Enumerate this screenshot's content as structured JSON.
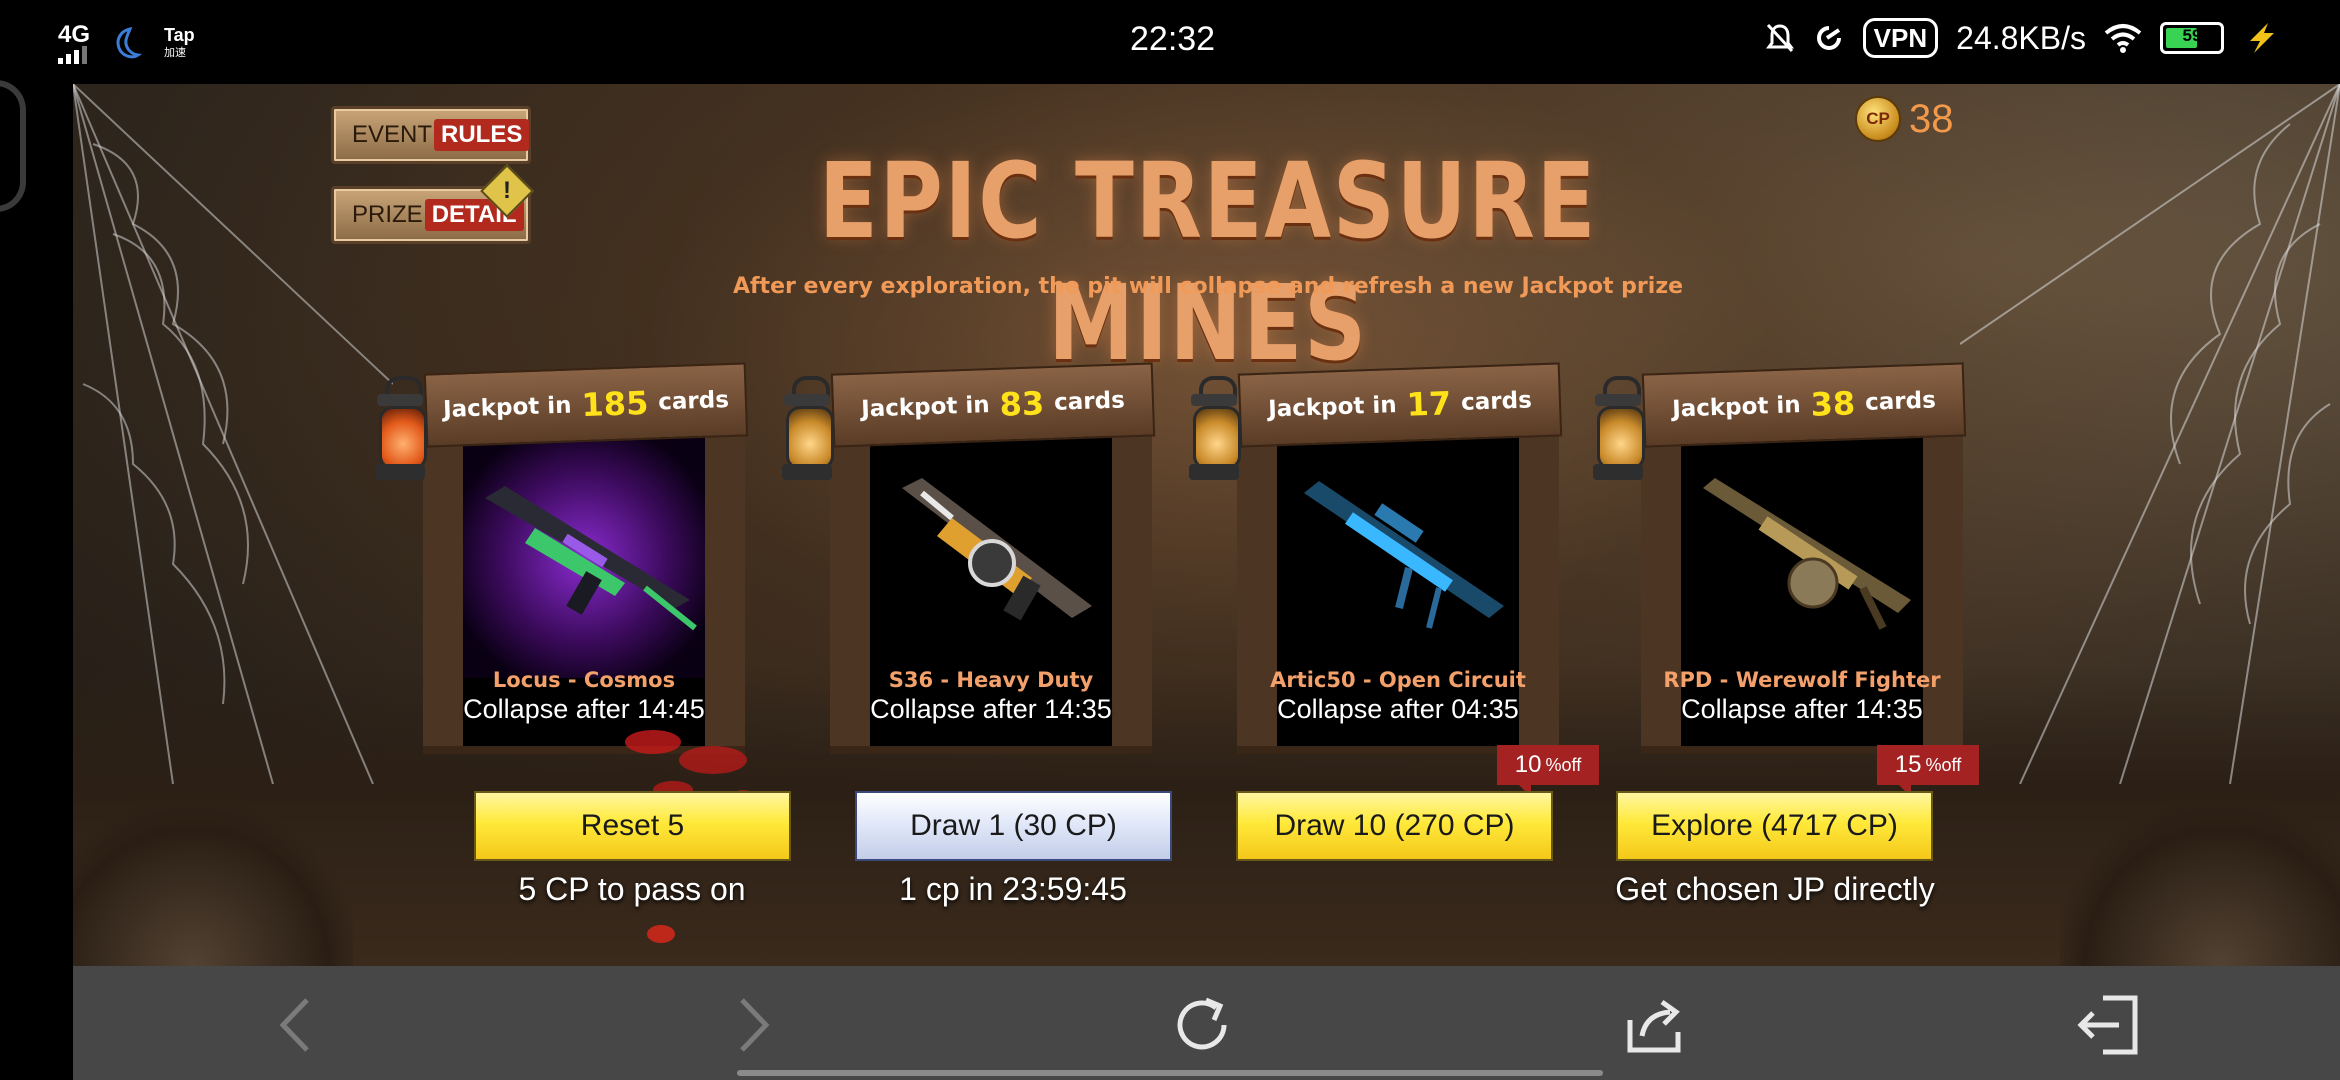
{
  "status_bar": {
    "network": "4G",
    "app_tap": "Tap",
    "app_tap_sub": "加速",
    "time": "22:32",
    "vpn": "VPN",
    "speed": "24.8KB/s",
    "battery": "59"
  },
  "buttons": {
    "event_label": "EVENT",
    "event_tag": "RULES",
    "prize_label": "PRIZE",
    "prize_tag": "DETAIL"
  },
  "cp": {
    "coin_label": "CP",
    "balance": "38"
  },
  "title": "EPIC TREASURE MINES",
  "subtitle": "After every exploration, the pit will collapse and refresh a new Jackpot prize",
  "mines": [
    {
      "prefix": "Jackpot in",
      "count": "185",
      "suffix": "cards",
      "name": "Locus - Cosmos",
      "collapse": "Collapse after 14:45"
    },
    {
      "prefix": "Jackpot in",
      "count": "83",
      "suffix": "cards",
      "name": "S36 - Heavy Duty",
      "collapse": "Collapse after 14:35"
    },
    {
      "prefix": "Jackpot in",
      "count": "17",
      "suffix": "cards",
      "name": "Artic50 - Open Circuit",
      "collapse": "Collapse after 04:35"
    },
    {
      "prefix": "Jackpot in",
      "count": "38",
      "suffix": "cards",
      "name": "RPD - Werewolf Fighter",
      "collapse": "Collapse after 14:35"
    }
  ],
  "actions": [
    {
      "label": "Reset 5",
      "note": "5 CP to pass on"
    },
    {
      "label": "Draw 1 (30 CP)",
      "note": "1 cp in 23:59:45"
    },
    {
      "label": "Draw 10 (270 CP)",
      "note": "",
      "discount": "10",
      "discount_unit": "%off"
    },
    {
      "label": "Explore (4717 CP)",
      "note": "Get chosen JP directly",
      "discount": "15",
      "discount_unit": "%off"
    }
  ],
  "nav_icons": [
    "back-icon",
    "forward-icon",
    "refresh-icon",
    "share-icon",
    "exit-icon"
  ]
}
